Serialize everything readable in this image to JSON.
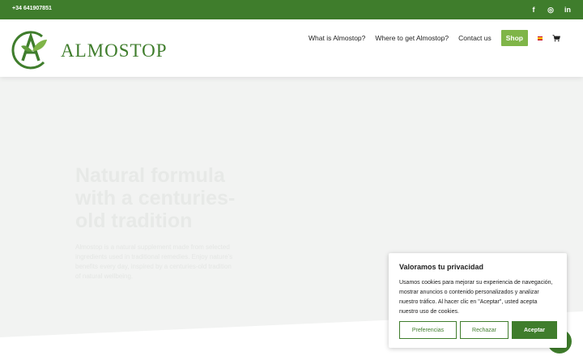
{
  "topbar": {
    "phone": "+34 641907851",
    "socials": [
      {
        "icon": "facebook-icon",
        "glyph": "f"
      },
      {
        "icon": "instagram-icon",
        "glyph": "◎"
      },
      {
        "icon": "linkedin-icon",
        "glyph": "in"
      }
    ]
  },
  "header": {
    "logo_text": "ALMOSTOP",
    "nav": [
      {
        "label": "What is Almostop?"
      },
      {
        "label": "Where to get Almostop?"
      },
      {
        "label": "Contact us"
      }
    ],
    "shop_label": "Shop",
    "language_icon": "spain-flag-icon",
    "cart_icon": "cart-icon"
  },
  "hero": {
    "title": "Natural formula with a centuries-old tradition",
    "text": "Almostop is a natural supplement made from selected ingredients used in traditional remedies. Enjoy nature's benefits every day, inspired by a centuries-old tradition of natural wellbeing."
  },
  "cookie": {
    "title": "Valoramos tu privacidad",
    "body": "Usamos cookies para mejorar su experiencia de navegación, mostrar anuncios o contenido personalizados y analizar nuestro tráfico. Al hacer clic en \"Aceptar\", usted acepta nuestro uso de cookies.",
    "preferences_label": "Preferencias",
    "reject_label": "Rechazar",
    "accept_label": "Aceptar"
  },
  "colors": {
    "brand_green": "#3f7d2c",
    "shop_green": "#7fb548",
    "hero_bg": "#f2f3f2"
  }
}
